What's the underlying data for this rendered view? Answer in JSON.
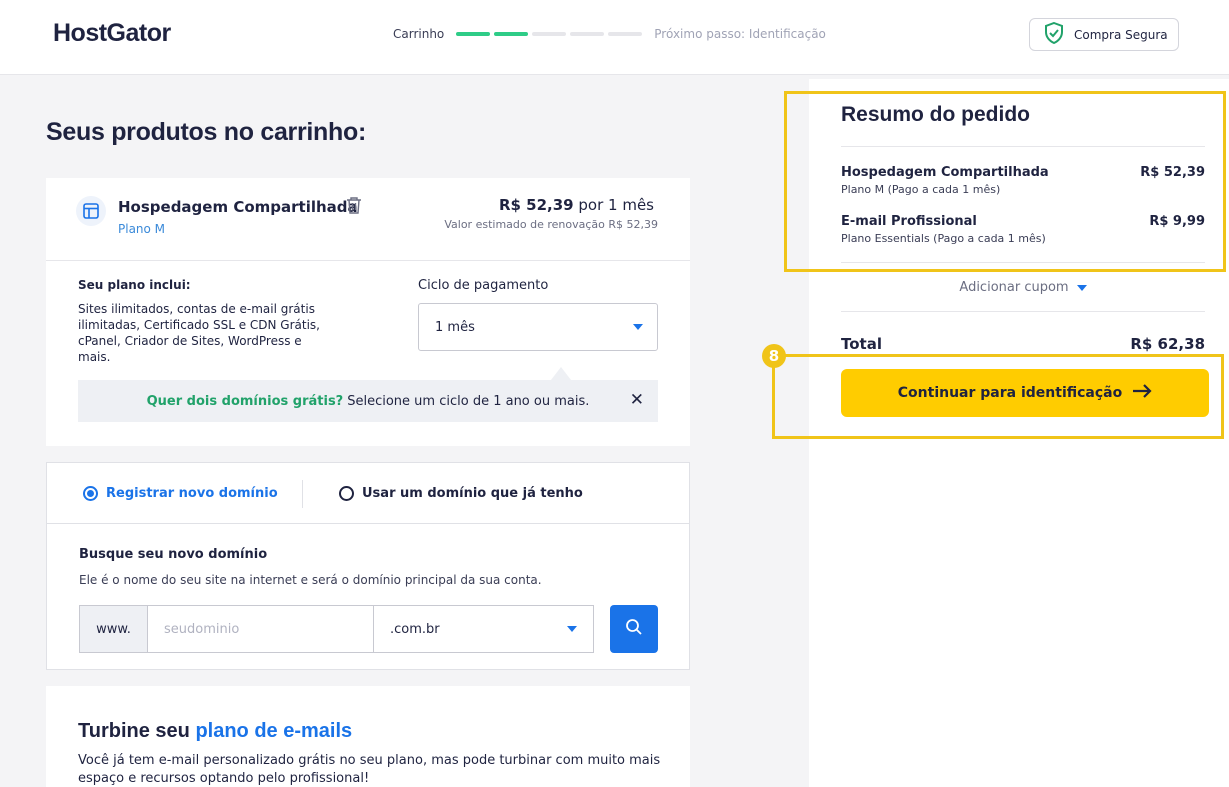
{
  "header": {
    "logo": "HostGator",
    "step_current": "Carrinho",
    "progress": {
      "completed_steps": 2,
      "total_steps": 5
    },
    "step_next": "Próximo passo: Identificação",
    "secure_label": "Compra Segura"
  },
  "page_title": "Seus produtos no carrinho:",
  "product": {
    "icon": "layout-icon",
    "name": "Hospedagem Compartilhada",
    "plan": "Plano M",
    "price": "R$ 52,39",
    "price_period": "por 1 mês",
    "renewal": "Valor estimado de renovação R$ 52,39",
    "includes_title": "Seu plano inclui:",
    "includes_text": "Sites ilimitados, contas de e-mail grátis ilimitadas, Certificado SSL e CDN Grátis, cPanel, Criador de Sites, WordPress e mais.",
    "cycle_label": "Ciclo de pagamento",
    "cycle_value": "1 mês",
    "promo_highlight": "Quer dois domínios grátis?",
    "promo_text": "Selecione um ciclo de 1 ano ou mais.",
    "promo_close": "✕"
  },
  "domain": {
    "option_new": "Registrar novo domínio",
    "option_existing": "Usar um domínio que já tenho",
    "selected": "new",
    "search_title": "Busque seu novo domínio",
    "search_desc": "Ele é o nome do seu site na internet e será o domínio principal da sua conta.",
    "prefix": "www.",
    "placeholder": "seudominio",
    "tld": ".com.br"
  },
  "email_upsell": {
    "title_prefix": "Turbine seu",
    "title_highlight": "plano de e-mails",
    "desc": "Você já tem e-mail personalizado grátis no seu plano, mas pode turbinar com muito mais espaço e recursos optando pelo profissional!"
  },
  "summary": {
    "title": "Resumo do pedido",
    "items": [
      {
        "name": "Hospedagem Compartilhada",
        "sub": "Plano M (Pago a cada 1 mês)",
        "price": "R$ 52,39"
      },
      {
        "name": "E-mail Profissional",
        "sub": "Plano Essentials (Pago a cada 1 mês)",
        "price": "R$ 9,99"
      }
    ],
    "coupon": "Adicionar cupom",
    "total_label": "Total",
    "total_value": "R$ 62,38",
    "cta": "Continuar para identificação"
  },
  "annotation": {
    "badge": "8"
  },
  "colors": {
    "brand_blue": "#1a73e8",
    "cta_yellow": "#ffcc00",
    "progress_green": "#2ecc87",
    "highlight": "#f0c419"
  }
}
